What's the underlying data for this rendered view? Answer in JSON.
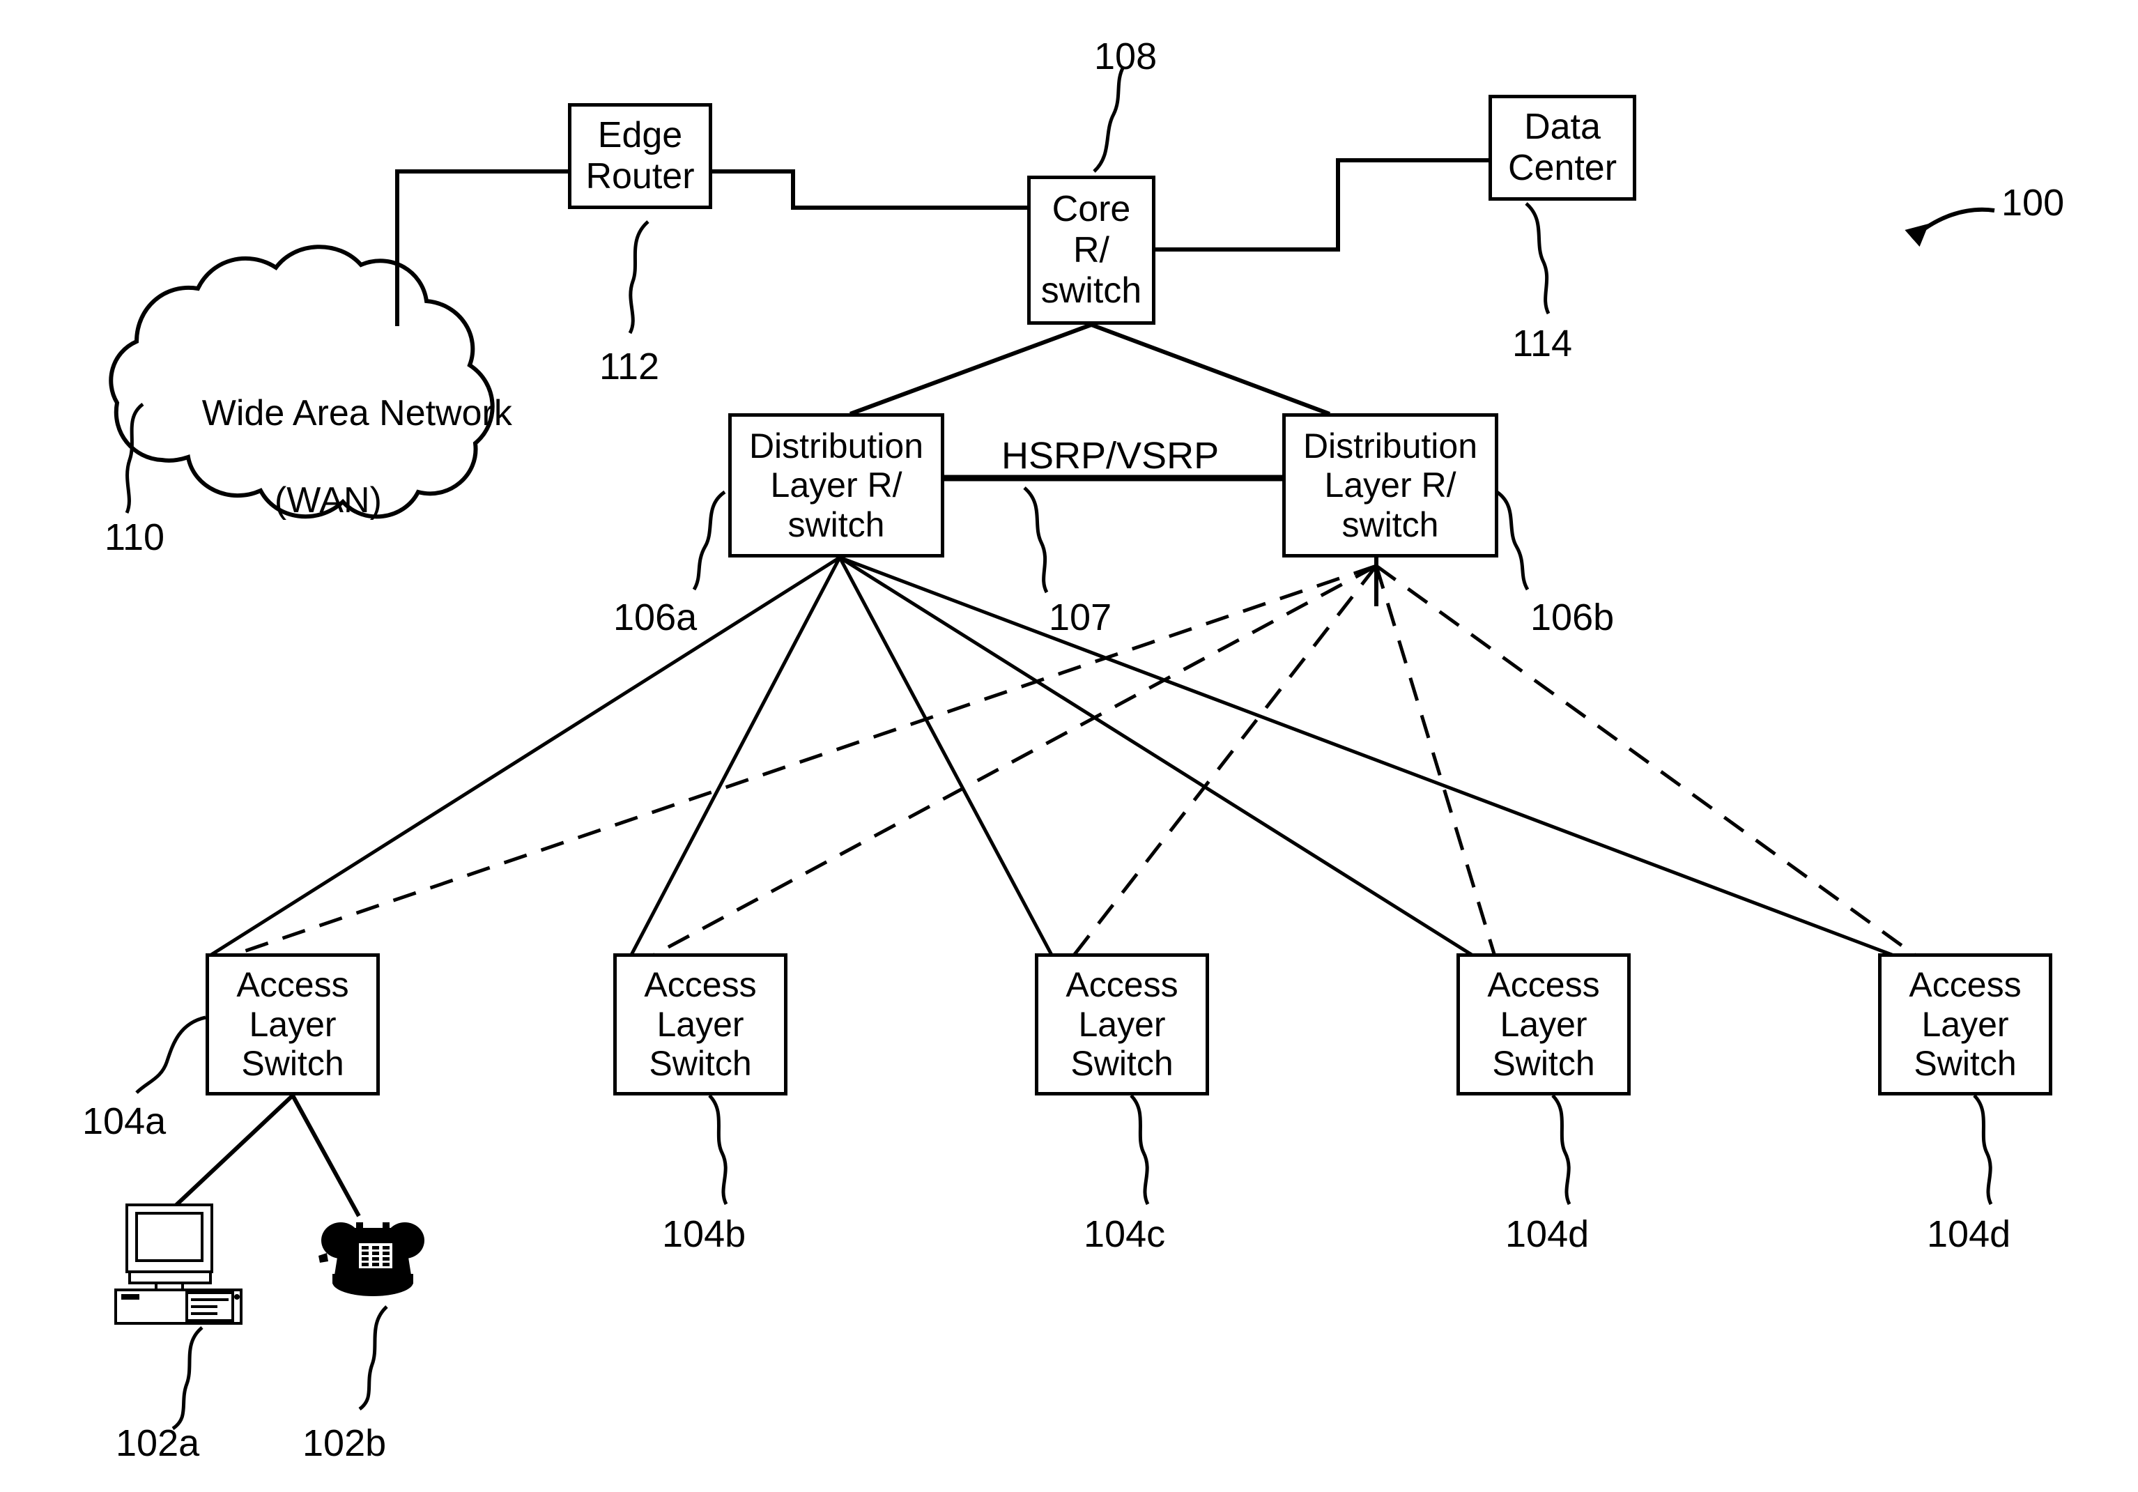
{
  "figure": {
    "number": "100",
    "title": "Network architecture diagram"
  },
  "nodes": {
    "wan": {
      "label_line1": "Wide Area Network",
      "label_line2": "(WAN)",
      "ref": "110"
    },
    "edge_router": {
      "label_line1": "Edge",
      "label_line2": "Router",
      "ref": "112"
    },
    "core_switch": {
      "label_line1": "Core",
      "label_line2": "R/",
      "label_line3": "switch",
      "ref": "108"
    },
    "data_center": {
      "label_line1": "Data",
      "label_line2": "Center",
      "ref": "114"
    },
    "dist_a": {
      "label_line1": "Distribution",
      "label_line2": "Layer R/",
      "label_line3": "switch",
      "ref": "106a"
    },
    "dist_b": {
      "label_line1": "Distribution",
      "label_line2": "Layer R/",
      "label_line3": "switch",
      "ref": "106b"
    },
    "access": [
      {
        "label_line1": "Access",
        "label_line2": "Layer",
        "label_line3": "Switch",
        "ref": "104a"
      },
      {
        "label_line1": "Access",
        "label_line2": "Layer",
        "label_line3": "Switch",
        "ref": "104b"
      },
      {
        "label_line1": "Access",
        "label_line2": "Layer",
        "label_line3": "Switch",
        "ref": "104c"
      },
      {
        "label_line1": "Access",
        "label_line2": "Layer",
        "label_line3": "Switch",
        "ref": "104d"
      },
      {
        "label_line1": "Access",
        "label_line2": "Layer",
        "label_line3": "Switch",
        "ref": "104d"
      }
    ],
    "endpoints": [
      {
        "icon": "desktop-computer-icon",
        "ref": "102a"
      },
      {
        "icon": "desk-telephone-icon",
        "ref": "102b"
      }
    ]
  },
  "links": {
    "redundancy_protocol_label": "HSRP/VSRP",
    "redundancy_protocol_ref": "107"
  }
}
